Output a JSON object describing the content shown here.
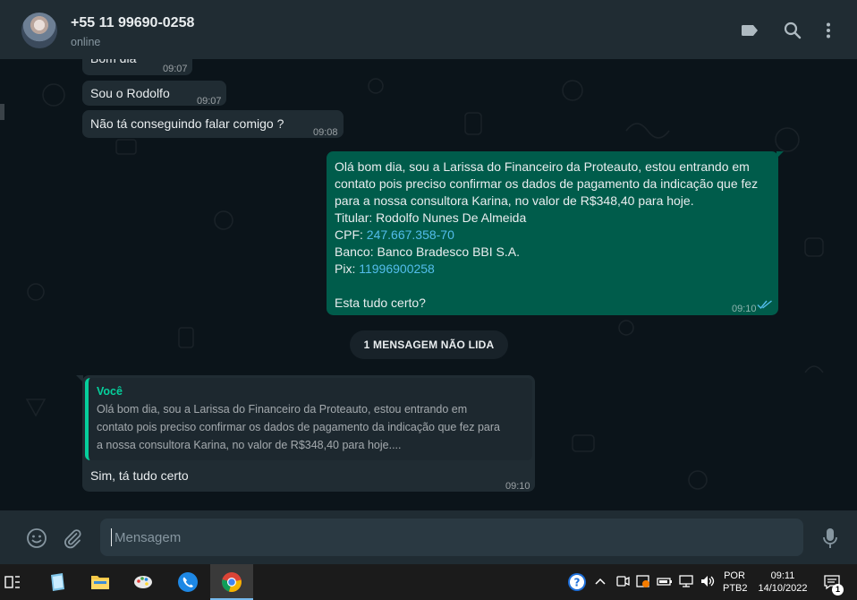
{
  "header": {
    "contact_name": "+55 11 99690-0258",
    "status": "online",
    "icons": [
      "label-icon",
      "search-icon",
      "menu-icon"
    ]
  },
  "messages": [
    {
      "direction": "in",
      "text": "Bom dia",
      "time": "09:07"
    },
    {
      "direction": "in",
      "text": "Sou o Rodolfo",
      "time": "09:07"
    },
    {
      "direction": "in",
      "text": "Não tá conseguindo falar comigo ?",
      "time": "09:08"
    },
    {
      "direction": "out",
      "lines": [
        "Olá bom dia, sou a Larissa do Financeiro da Proteauto, estou entrando em",
        "contato pois preciso confirmar os dados de pagamento da indicação que fez",
        "para a nossa consultora Karina, no valor de R$348,40 para hoje.",
        "Titular: Rodolfo Nunes De Almeida"
      ],
      "cpf_label": "CPF: ",
      "cpf_value": "247.667.358-70",
      "banco": "Banco: Banco Bradesco BBI S.A.",
      "pix_label": "Pix: ",
      "pix_value": "11996900258",
      "closing": "Esta tudo certo?",
      "time": "09:10",
      "status": "read"
    },
    {
      "direction": "in",
      "quote_author": "Você",
      "quote_lines": [
        "Olá bom dia, sou a Larissa do Financeiro da Proteauto, estou entrando em",
        "contato pois preciso confirmar os dados de pagamento da indicação que fez para",
        "a nossa consultora Karina, no valor de R$348,40 para hoje...."
      ],
      "text": "Sim, tá tudo certo",
      "time": "09:10"
    }
  ],
  "unread_divider": "1 MENSAGEM NÃO LIDA",
  "composer": {
    "placeholder": "Mensagem"
  },
  "taskbar": {
    "language": [
      "POR",
      "PTB2"
    ],
    "time": "09:11",
    "date": "14/10/2022",
    "notification_count": "1"
  },
  "colors": {
    "accent": "#06cf9c",
    "outgoing_bubble": "#005c4b",
    "incoming_bubble": "#202c33",
    "link": "#53bdeb",
    "read_ticks": "#53bdeb"
  }
}
